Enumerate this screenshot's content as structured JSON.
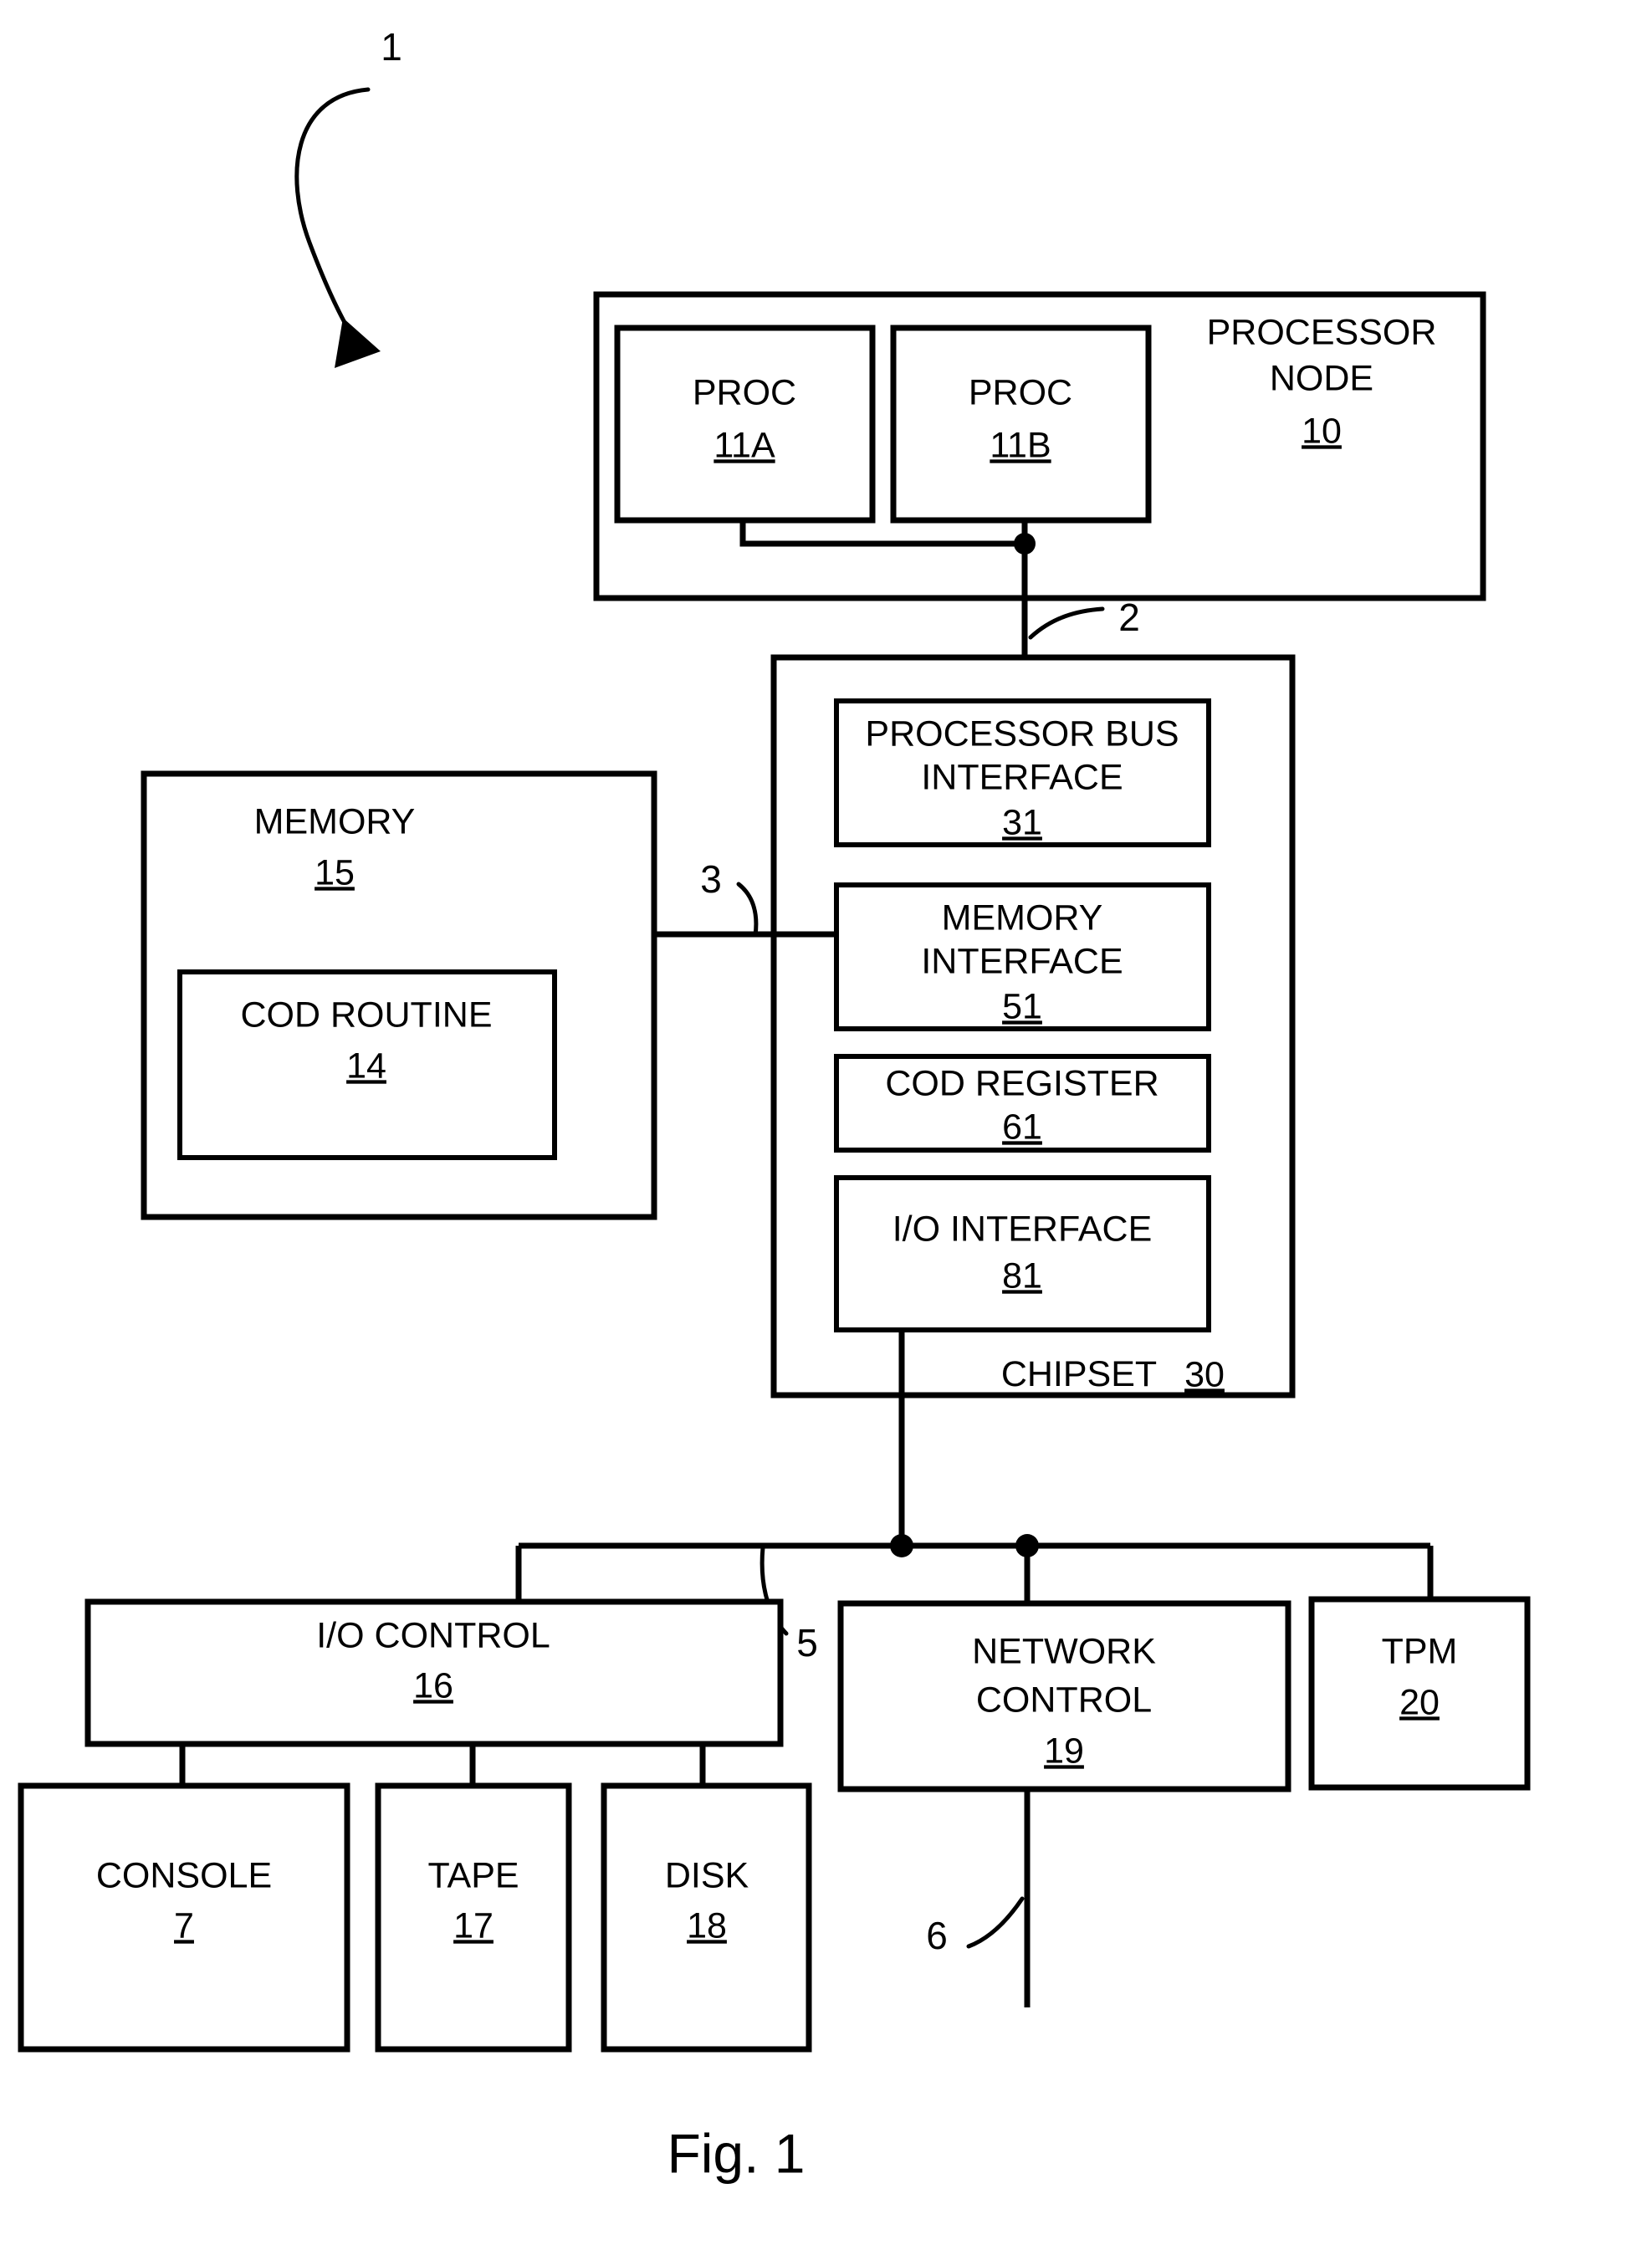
{
  "figure": {
    "caption": "Fig. 1",
    "top_reference": "1"
  },
  "blocks": {
    "processor_node": {
      "label": "PROCESSOR NODE",
      "label_line1": "PROCESSOR",
      "label_line2": "NODE",
      "number": "10"
    },
    "proc_a": {
      "label": "PROC",
      "number": "11A"
    },
    "proc_b": {
      "label": "PROC",
      "number": "11B"
    },
    "memory": {
      "label": "MEMORY",
      "number": "15"
    },
    "cod_routine": {
      "label": "COD ROUTINE",
      "number": "14"
    },
    "chipset": {
      "label": "CHIPSET",
      "number": "30"
    },
    "processor_bus_interface": {
      "label_line1": "PROCESSOR BUS",
      "label_line2": "INTERFACE",
      "number": "31"
    },
    "memory_interface": {
      "label_line1": "MEMORY",
      "label_line2": "INTERFACE",
      "number": "51"
    },
    "cod_register": {
      "label": "COD REGISTER",
      "number": "61"
    },
    "io_interface": {
      "label": "I/O INTERFACE",
      "number": "81"
    },
    "io_control": {
      "label": "I/O CONTROL",
      "number": "16"
    },
    "console": {
      "label": "CONSOLE",
      "number": "7"
    },
    "tape": {
      "label": "TAPE",
      "number": "17"
    },
    "disk": {
      "label": "DISK",
      "number": "18"
    },
    "network_control": {
      "label_line1": "NETWORK",
      "label_line2": "CONTROL",
      "number": "19"
    },
    "tpm": {
      "label": "TPM",
      "number": "20"
    }
  },
  "connectors": {
    "processor_bus": "2",
    "memory_bus": "3",
    "io_bus": "5",
    "network_link": "6"
  }
}
